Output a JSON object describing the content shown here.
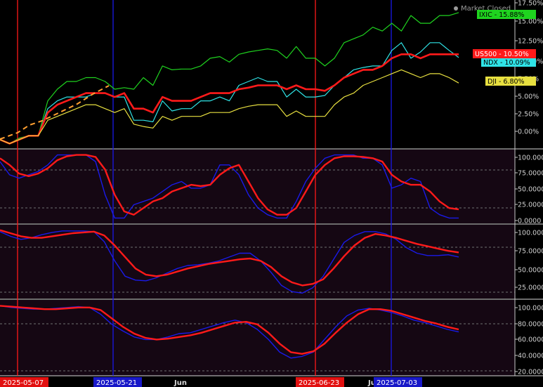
{
  "status": {
    "label": "Market Closed",
    "icon": "status-dot-icon"
  },
  "colors": {
    "green": "#1fd31f",
    "cyan": "#2fe3e6",
    "red": "#ff1a1a",
    "yellow": "#e8e040",
    "blue": "#1a1ae8",
    "orange": "#ffa030",
    "osc_bg": "#150713",
    "date_red": "#e21010",
    "date_blue": "#1818c8"
  },
  "chart_data": [
    {
      "type": "line",
      "panel": "price",
      "x": [
        "2025-05-01",
        "2025-05-02",
        "2025-05-05",
        "2025-05-06",
        "2025-05-07",
        "2025-05-08",
        "2025-05-09",
        "2025-05-12",
        "2025-05-13",
        "2025-05-14",
        "2025-05-15",
        "2025-05-16",
        "2025-05-19",
        "2025-05-20",
        "2025-05-21",
        "2025-05-22",
        "2025-05-23",
        "2025-05-27",
        "2025-05-28",
        "2025-05-29",
        "2025-05-30",
        "2025-06-02",
        "2025-06-03",
        "2025-06-04",
        "2025-06-05",
        "2025-06-06",
        "2025-06-09",
        "2025-06-10",
        "2025-06-11",
        "2025-06-12",
        "2025-06-13",
        "2025-06-16",
        "2025-06-17",
        "2025-06-18",
        "2025-06-20",
        "2025-06-23",
        "2025-06-24",
        "2025-06-25",
        "2025-06-26",
        "2025-06-27",
        "2025-06-30",
        "2025-07-01",
        "2025-07-02",
        "2025-07-03",
        "2025-07-07",
        "2025-07-08",
        "2025-07-09",
        "2025-07-10",
        "2025-07-11"
      ],
      "ylim": [
        -1.6,
        17.5
      ],
      "y_ticks": [
        "0.00%",
        "2.50%",
        "5.00%",
        "7.50%",
        "10.00%",
        "12.50%",
        "15.00%",
        "17.50%"
      ],
      "series": [
        {
          "name": "IXIC",
          "label": "IXIC - 15.88%",
          "color": "#1fd31f",
          "values": [
            -0.5,
            -1.0,
            -0.3,
            0.0,
            0.0,
            4.5,
            6.0,
            7.0,
            7.0,
            7.5,
            7.5,
            7.0,
            6.0,
            6.2,
            6.0,
            7.5,
            6.5,
            9.0,
            8.5,
            8.6,
            8.6,
            9.0,
            10.0,
            10.2,
            9.5,
            10.5,
            10.8,
            11.0,
            11.2,
            11.0,
            10.0,
            11.5,
            10.0,
            10.0,
            9.0,
            10.0,
            12.0,
            12.5,
            13.0,
            14.0,
            13.5,
            14.5,
            13.5,
            15.5,
            14.5,
            14.5,
            15.5,
            15.5,
            15.88
          ]
        },
        {
          "name": "NDX",
          "label": "NDX - 10.09%",
          "color": "#2fe3e6",
          "values": [
            -0.5,
            -1.0,
            -0.5,
            0.0,
            0.0,
            3.5,
            4.5,
            5.0,
            5.0,
            5.0,
            5.5,
            5.5,
            5.0,
            5.0,
            2.0,
            2.0,
            1.8,
            4.5,
            3.2,
            3.5,
            3.5,
            4.5,
            4.5,
            5.0,
            4.5,
            6.5,
            7.0,
            7.5,
            7.0,
            7.0,
            5.0,
            6.0,
            5.0,
            5.0,
            5.2,
            6.5,
            7.5,
            8.5,
            8.8,
            9.0,
            9.0,
            11.0,
            12.0,
            10.0,
            10.8,
            12.0,
            12.0,
            11.0,
            10.09
          ]
        },
        {
          "name": "US500",
          "label": "US500 - 10.50%",
          "color": "#ff1a1a",
          "values": [
            -0.5,
            -1.0,
            -0.5,
            0.0,
            0.0,
            3.0,
            4.0,
            4.5,
            5.0,
            5.5,
            5.5,
            5.5,
            5.0,
            5.5,
            3.5,
            3.5,
            3.0,
            5.0,
            4.5,
            4.5,
            4.5,
            5.0,
            5.5,
            5.5,
            5.5,
            6.0,
            6.2,
            6.5,
            6.5,
            6.5,
            6.0,
            6.5,
            6.0,
            6.0,
            5.8,
            6.5,
            7.5,
            8.0,
            8.5,
            8.5,
            9.0,
            10.0,
            10.5,
            10.5,
            10.0,
            10.5,
            10.5,
            10.5,
            10.5
          ]
        },
        {
          "name": "DJI",
          "label": "DJI - 6.80%",
          "color": "#e8e040",
          "values": [
            -0.5,
            -1.0,
            -0.5,
            0.0,
            0.0,
            2.0,
            2.5,
            3.0,
            3.5,
            4.0,
            4.0,
            3.5,
            3.0,
            3.5,
            1.5,
            1.2,
            1.0,
            2.5,
            2.0,
            2.5,
            2.5,
            2.5,
            3.0,
            3.0,
            3.0,
            3.5,
            3.8,
            4.0,
            4.0,
            4.0,
            2.5,
            3.2,
            2.5,
            2.5,
            2.5,
            4.0,
            5.0,
            5.5,
            6.5,
            7.0,
            7.5,
            8.0,
            8.5,
            8.0,
            7.5,
            8.0,
            8.0,
            7.5,
            6.8
          ]
        }
      ]
    },
    {
      "type": "line",
      "panel": "oscillator-1",
      "ylim": [
        -3,
        108
      ],
      "y_ticks": [
        "0.0000",
        "25.0000",
        "50.0000",
        "75.0000",
        "100.0000"
      ],
      "series": [
        {
          "name": "K",
          "color": "#1a1ae8",
          "values": [
            90,
            70,
            65,
            70,
            75,
            85,
            100,
            100,
            100,
            100,
            90,
            40,
            5,
            5,
            25,
            30,
            35,
            45,
            55,
            60,
            50,
            50,
            55,
            85,
            85,
            70,
            40,
            20,
            10,
            5,
            5,
            30,
            60,
            80,
            95,
            100,
            100,
            100,
            95,
            95,
            85,
            50,
            55,
            65,
            60,
            20,
            10,
            5,
            5
          ]
        },
        {
          "name": "D",
          "color": "#ff1a1a",
          "values": [
            95,
            85,
            72,
            68,
            72,
            80,
            92,
            98,
            100,
            100,
            97,
            78,
            40,
            15,
            10,
            20,
            30,
            35,
            45,
            50,
            55,
            53,
            55,
            70,
            80,
            85,
            60,
            35,
            18,
            10,
            10,
            20,
            45,
            70,
            85,
            95,
            98,
            98,
            97,
            95,
            90,
            70,
            60,
            55,
            55,
            45,
            30,
            20,
            18
          ]
        }
      ]
    },
    {
      "type": "line",
      "panel": "oscillator-2",
      "ylim": [
        11,
        107
      ],
      "y_ticks": [
        "25.0000",
        "50.0000",
        "75.0000",
        "100.0000"
      ],
      "series": [
        {
          "name": "K",
          "color": "#1a1ae8",
          "values": [
            98,
            92,
            88,
            90,
            94,
            97,
            99,
            99,
            99,
            98,
            85,
            60,
            40,
            35,
            34,
            38,
            44,
            50,
            54,
            55,
            57,
            60,
            65,
            70,
            70,
            60,
            45,
            28,
            20,
            18,
            25,
            40,
            62,
            84,
            93,
            98,
            98,
            95,
            88,
            77,
            70,
            67,
            67,
            68,
            65
          ]
        },
        {
          "name": "D",
          "color": "#ff1a1a",
          "values": [
            100,
            96,
            92,
            90,
            90,
            92,
            94,
            96,
            97,
            98,
            93,
            80,
            65,
            50,
            42,
            40,
            42,
            46,
            50,
            53,
            56,
            58,
            60,
            62,
            63,
            60,
            52,
            40,
            32,
            28,
            30,
            36,
            50,
            66,
            80,
            90,
            95,
            93,
            90,
            86,
            82,
            79,
            76,
            73,
            71
          ]
        }
      ]
    },
    {
      "type": "line",
      "panel": "oscillator-3",
      "ylim": [
        17,
        107
      ],
      "y_ticks": [
        "20.0000",
        "40.0000",
        "60.0000",
        "80.0000",
        "100.0000"
      ],
      "series": [
        {
          "name": "K",
          "color": "#1a1ae8",
          "values": [
            100,
            98,
            97,
            96,
            96,
            97,
            98,
            99,
            98,
            90,
            78,
            70,
            63,
            60,
            60,
            63,
            67,
            68,
            72,
            76,
            80,
            83,
            80,
            72,
            60,
            45,
            38,
            40,
            45,
            60,
            75,
            88,
            95,
            97,
            95,
            92,
            88,
            83,
            80,
            76,
            72,
            69
          ]
        },
        {
          "name": "D",
          "color": "#ff1a1a",
          "values": [
            100,
            99,
            98,
            97,
            96,
            96,
            97,
            98,
            98,
            95,
            85,
            75,
            67,
            62,
            60,
            61,
            63,
            65,
            68,
            72,
            76,
            80,
            81,
            78,
            68,
            55,
            45,
            43,
            46,
            55,
            68,
            80,
            90,
            96,
            96,
            94,
            90,
            86,
            82,
            79,
            75,
            72
          ]
        }
      ]
    }
  ],
  "date_labels": [
    {
      "text": "2025-05-07",
      "style": "red"
    },
    {
      "text": "2025-05-21",
      "style": "blue"
    },
    {
      "text": "Jun",
      "style": "plain"
    },
    {
      "text": "2025-06-23",
      "style": "red"
    },
    {
      "text": "Ju",
      "style": "plain"
    },
    {
      "text": "2025-07-03",
      "style": "blue"
    }
  ]
}
